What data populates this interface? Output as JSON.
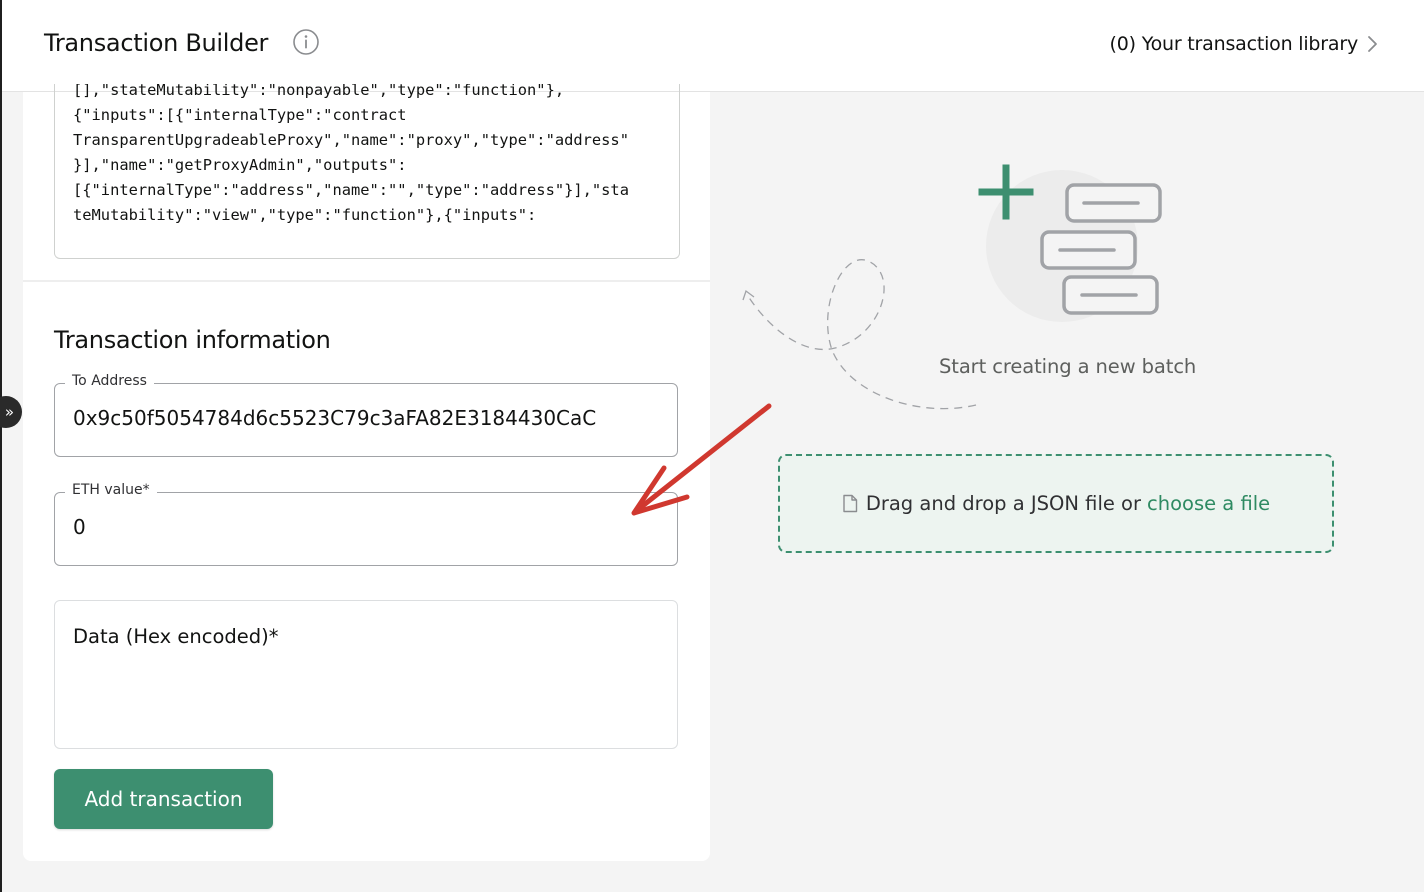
{
  "header": {
    "title": "Transaction Builder",
    "library_link": "(0) Your transaction library"
  },
  "abi_preview": {
    "lines": [
      "[],\"stateMutability\":\"nonpayable\",\"type\":\"function\"},",
      "{\"inputs\":[{\"internalType\":\"contract",
      "TransparentUpgradeableProxy\",\"name\":\"proxy\",\"type\":\"address\"",
      "}],\"name\":\"getProxyAdmin\",\"outputs\":",
      "[{\"internalType\":\"address\",\"name\":\"\",\"type\":\"address\"}],\"sta",
      "teMutability\":\"view\",\"type\":\"function\"},{\"inputs\":"
    ]
  },
  "form": {
    "section_title": "Transaction information",
    "to_address_label": "To Address",
    "to_address_value": "0x9c50f5054784d6c5523C79c3aFA82E3184430CaC",
    "eth_value_label": "ETH value*",
    "eth_value": "0",
    "data_label": "Data (Hex encoded)*",
    "submit_label": "Add transaction"
  },
  "sidebar_toggle": {
    "glyph": "»"
  },
  "batch": {
    "empty_text": "Start creating a new batch",
    "dropzone_text": "Drag and drop a JSON file or",
    "dropzone_link": "choose a file"
  },
  "colors": {
    "accent": "#3d8f70",
    "annotation_arrow": "#d0382f"
  },
  "icons": [
    "info-icon",
    "chevron-right-icon",
    "file-icon",
    "expand-sidebar-icon"
  ]
}
